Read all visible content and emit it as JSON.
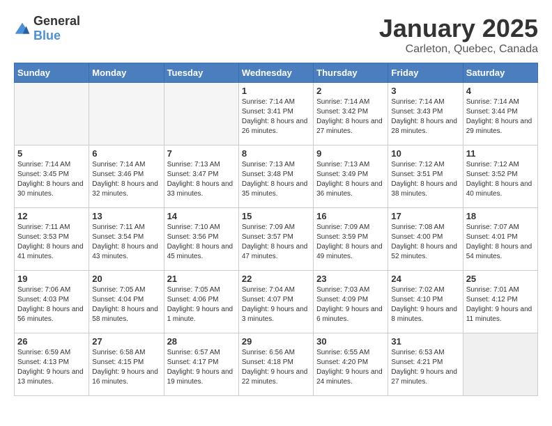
{
  "logo": {
    "general": "General",
    "blue": "Blue"
  },
  "header": {
    "month": "January 2025",
    "location": "Carleton, Quebec, Canada"
  },
  "weekdays": [
    "Sunday",
    "Monday",
    "Tuesday",
    "Wednesday",
    "Thursday",
    "Friday",
    "Saturday"
  ],
  "weeks": [
    [
      {
        "day": "",
        "info": ""
      },
      {
        "day": "",
        "info": ""
      },
      {
        "day": "",
        "info": ""
      },
      {
        "day": "1",
        "info": "Sunrise: 7:14 AM\nSunset: 3:41 PM\nDaylight: 8 hours\nand 26 minutes."
      },
      {
        "day": "2",
        "info": "Sunrise: 7:14 AM\nSunset: 3:42 PM\nDaylight: 8 hours\nand 27 minutes."
      },
      {
        "day": "3",
        "info": "Sunrise: 7:14 AM\nSunset: 3:43 PM\nDaylight: 8 hours\nand 28 minutes."
      },
      {
        "day": "4",
        "info": "Sunrise: 7:14 AM\nSunset: 3:44 PM\nDaylight: 8 hours\nand 29 minutes."
      }
    ],
    [
      {
        "day": "5",
        "info": "Sunrise: 7:14 AM\nSunset: 3:45 PM\nDaylight: 8 hours\nand 30 minutes."
      },
      {
        "day": "6",
        "info": "Sunrise: 7:14 AM\nSunset: 3:46 PM\nDaylight: 8 hours\nand 32 minutes."
      },
      {
        "day": "7",
        "info": "Sunrise: 7:13 AM\nSunset: 3:47 PM\nDaylight: 8 hours\nand 33 minutes."
      },
      {
        "day": "8",
        "info": "Sunrise: 7:13 AM\nSunset: 3:48 PM\nDaylight: 8 hours\nand 35 minutes."
      },
      {
        "day": "9",
        "info": "Sunrise: 7:13 AM\nSunset: 3:49 PM\nDaylight: 8 hours\nand 36 minutes."
      },
      {
        "day": "10",
        "info": "Sunrise: 7:12 AM\nSunset: 3:51 PM\nDaylight: 8 hours\nand 38 minutes."
      },
      {
        "day": "11",
        "info": "Sunrise: 7:12 AM\nSunset: 3:52 PM\nDaylight: 8 hours\nand 40 minutes."
      }
    ],
    [
      {
        "day": "12",
        "info": "Sunrise: 7:11 AM\nSunset: 3:53 PM\nDaylight: 8 hours\nand 41 minutes."
      },
      {
        "day": "13",
        "info": "Sunrise: 7:11 AM\nSunset: 3:54 PM\nDaylight: 8 hours\nand 43 minutes."
      },
      {
        "day": "14",
        "info": "Sunrise: 7:10 AM\nSunset: 3:56 PM\nDaylight: 8 hours\nand 45 minutes."
      },
      {
        "day": "15",
        "info": "Sunrise: 7:09 AM\nSunset: 3:57 PM\nDaylight: 8 hours\nand 47 minutes."
      },
      {
        "day": "16",
        "info": "Sunrise: 7:09 AM\nSunset: 3:59 PM\nDaylight: 8 hours\nand 49 minutes."
      },
      {
        "day": "17",
        "info": "Sunrise: 7:08 AM\nSunset: 4:00 PM\nDaylight: 8 hours\nand 52 minutes."
      },
      {
        "day": "18",
        "info": "Sunrise: 7:07 AM\nSunset: 4:01 PM\nDaylight: 8 hours\nand 54 minutes."
      }
    ],
    [
      {
        "day": "19",
        "info": "Sunrise: 7:06 AM\nSunset: 4:03 PM\nDaylight: 8 hours\nand 56 minutes."
      },
      {
        "day": "20",
        "info": "Sunrise: 7:05 AM\nSunset: 4:04 PM\nDaylight: 8 hours\nand 58 minutes."
      },
      {
        "day": "21",
        "info": "Sunrise: 7:05 AM\nSunset: 4:06 PM\nDaylight: 9 hours\nand 1 minute."
      },
      {
        "day": "22",
        "info": "Sunrise: 7:04 AM\nSunset: 4:07 PM\nDaylight: 9 hours\nand 3 minutes."
      },
      {
        "day": "23",
        "info": "Sunrise: 7:03 AM\nSunset: 4:09 PM\nDaylight: 9 hours\nand 6 minutes."
      },
      {
        "day": "24",
        "info": "Sunrise: 7:02 AM\nSunset: 4:10 PM\nDaylight: 9 hours\nand 8 minutes."
      },
      {
        "day": "25",
        "info": "Sunrise: 7:01 AM\nSunset: 4:12 PM\nDaylight: 9 hours\nand 11 minutes."
      }
    ],
    [
      {
        "day": "26",
        "info": "Sunrise: 6:59 AM\nSunset: 4:13 PM\nDaylight: 9 hours\nand 13 minutes."
      },
      {
        "day": "27",
        "info": "Sunrise: 6:58 AM\nSunset: 4:15 PM\nDaylight: 9 hours\nand 16 minutes."
      },
      {
        "day": "28",
        "info": "Sunrise: 6:57 AM\nSunset: 4:17 PM\nDaylight: 9 hours\nand 19 minutes."
      },
      {
        "day": "29",
        "info": "Sunrise: 6:56 AM\nSunset: 4:18 PM\nDaylight: 9 hours\nand 22 minutes."
      },
      {
        "day": "30",
        "info": "Sunrise: 6:55 AM\nSunset: 4:20 PM\nDaylight: 9 hours\nand 24 minutes."
      },
      {
        "day": "31",
        "info": "Sunrise: 6:53 AM\nSunset: 4:21 PM\nDaylight: 9 hours\nand 27 minutes."
      },
      {
        "day": "",
        "info": ""
      }
    ]
  ]
}
